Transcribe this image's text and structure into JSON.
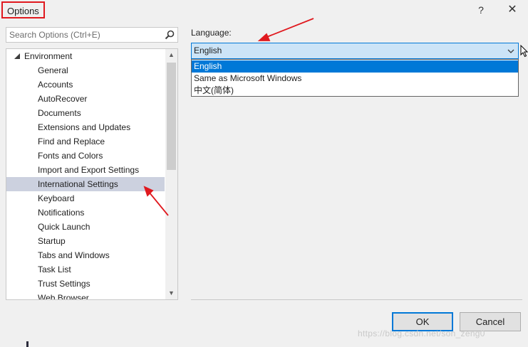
{
  "window": {
    "title": "Options",
    "help_label": "?",
    "close_label": "✕"
  },
  "search": {
    "placeholder": "Search Options (Ctrl+E)",
    "value": ""
  },
  "tree": {
    "root_label": "Environment",
    "items": [
      "General",
      "Accounts",
      "AutoRecover",
      "Documents",
      "Extensions and Updates",
      "Find and Replace",
      "Fonts and Colors",
      "Import and Export Settings",
      "International Settings",
      "Keyboard",
      "Notifications",
      "Quick Launch",
      "Startup",
      "Tabs and Windows",
      "Task List",
      "Trust Settings",
      "Web Browser"
    ],
    "selected_item": "International Settings",
    "scroll_up": "▲",
    "scroll_down": "▼"
  },
  "language": {
    "label": "Language:",
    "selected": "English",
    "options": [
      "English",
      "Same as Microsoft Windows",
      "中文(简体)"
    ]
  },
  "buttons": {
    "ok": "OK",
    "cancel": "Cancel"
  },
  "watermark": "https://blog.csdn.net/son_zeng0",
  "colors": {
    "accent": "#0078d7",
    "selection_tree": "#ccd1df",
    "annotation_red": "#e0191f"
  },
  "icons": {
    "search": "search-icon",
    "chevron": "chevron-down-icon",
    "close": "close-icon",
    "help": "help-icon",
    "cursor": "mouse-pointer-icon"
  }
}
